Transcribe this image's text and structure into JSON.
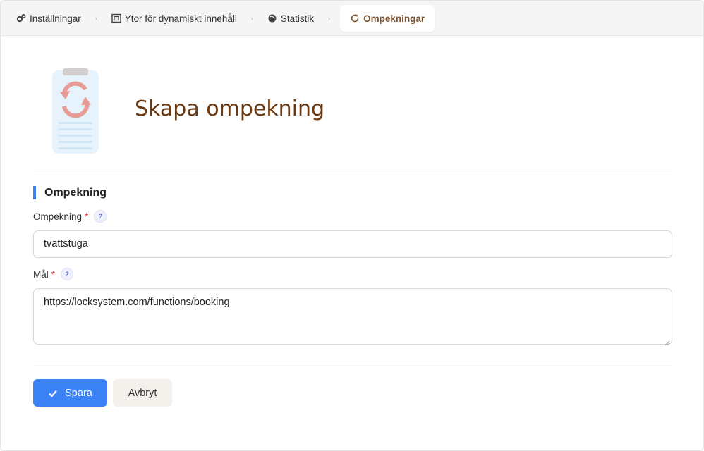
{
  "tabs": [
    {
      "label": "Inställningar",
      "icon": "gears-icon"
    },
    {
      "label": "Ytor för dynamiskt innehåll",
      "icon": "frame-icon"
    },
    {
      "label": "Statistik",
      "icon": "globe-icon"
    },
    {
      "label": "Ompekningar",
      "icon": "refresh-icon",
      "active": true
    }
  ],
  "page": {
    "title": "Skapa ompekning"
  },
  "section": {
    "title": "Ompekning"
  },
  "fields": {
    "redirect": {
      "label": "Ompekning",
      "required": "*",
      "help": "?",
      "value": "tvattstuga"
    },
    "target": {
      "label": "Mål",
      "required": "*",
      "help": "?",
      "value": "https://locksystem.com/functions/booking"
    }
  },
  "actions": {
    "save_label": "Spara",
    "cancel_label": "Avbryt"
  },
  "colors": {
    "accent": "#3b82f6",
    "title": "#6b3a12",
    "active_tab": "#7b5230",
    "required": "#e53935"
  }
}
